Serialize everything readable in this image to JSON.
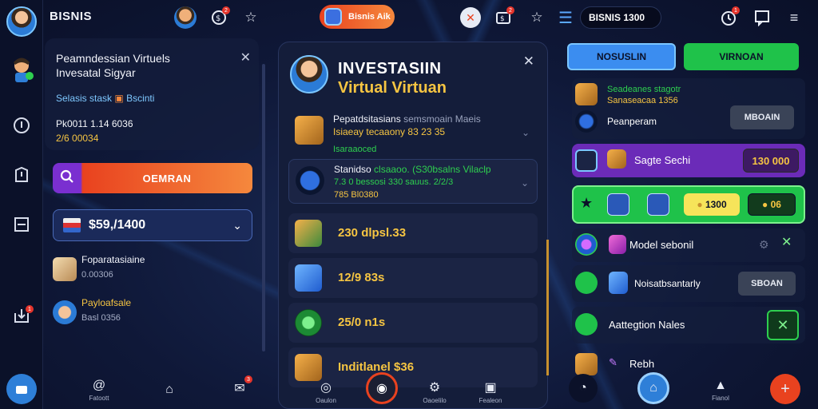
{
  "topbar": {
    "title": "BISNIS",
    "orange_pill_label": "Bisnis Aik",
    "field_value": "BISNIS 1300",
    "badges": {
      "tb_a": "2",
      "tb_b": "2",
      "tb_c": "1"
    }
  },
  "left_panel": {
    "title": "Peamndessian Virtuels Invesatal Sigyar",
    "subtitle": "Selasis stask",
    "subtitle_tag": "Bscinti",
    "num1": "Pk0011 1.14 6036",
    "num2": "2/6 00034",
    "search_button_label": "OEMRAN",
    "select_value": "$59,/1400",
    "items": [
      {
        "title": "Foparatasiaine",
        "sub": "0.00306"
      },
      {
        "title": "Payloafsale",
        "sub": "Basl 0356"
      }
    ]
  },
  "modal": {
    "title_line1": "INVESTASIIN",
    "title_line2": "Virtual Virtuan",
    "row1": {
      "line1": "Pepatdsitasians",
      "line1_b": "semsmoain Maeis",
      "line2": "Isiaeay tecaaony 83 23 35",
      "line3": "Isaraaoced"
    },
    "row2": {
      "line1": "Stanidso",
      "line1_b": "clsaaoo. (S30bsalns Vilaclp",
      "line2": "7.3 0 bessosi 330 sauus. 2/2/3",
      "line3": "785 Bl0380"
    },
    "items": [
      {
        "value": "230 dlpsl.33"
      },
      {
        "value": "12/9 83s"
      },
      {
        "value": "25/0 n1s"
      },
      {
        "value": "Inditlanel $36"
      }
    ]
  },
  "right_panel": {
    "tab_left": "NOSUSLIN",
    "tab_right": "VIRNOAN",
    "r1": {
      "line1": "Seadeanes stagotr",
      "line2": "Sanaseacaa 1356",
      "label": "Peanperam",
      "button": "MBOAIN"
    },
    "r2": {
      "label": "Sagte Sechi",
      "value": "130 000"
    },
    "r3": {
      "value1": "1300",
      "value2": "06"
    },
    "r4": {
      "label": "Model sebonil"
    },
    "r5": {
      "label": "Noisatbsantarly",
      "button": "SBOAN"
    },
    "r6": {
      "label": "Aattegtion Nales"
    },
    "r7": {
      "label": "Rebh"
    }
  },
  "bottombar": {
    "labels": {
      "b1": "Fatoott",
      "b3": "Oaulon",
      "b5": "Oaoelilo",
      "b6": "Fealeon",
      "b9": "Fianol"
    }
  },
  "colors": {
    "accent_orange": "#f5883d",
    "accent_purple": "#7a2fd0",
    "accent_green": "#2ecf4f",
    "accent_blue": "#3b8df0",
    "gold": "#f6c542"
  }
}
